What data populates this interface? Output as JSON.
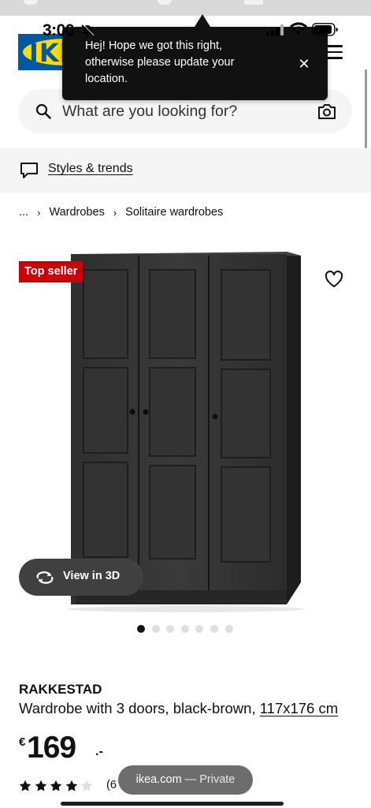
{
  "status_bar": {
    "time": "3:00",
    "icons": [
      "bell-muted-icon",
      "cellular-signal-icon",
      "wifi-icon",
      "battery-icon"
    ]
  },
  "header": {
    "logo_text": "IKEA",
    "menu_icon": "hamburger-menu-icon"
  },
  "location_popup": {
    "message": "Hej! Hope we got this right, otherwise please update your location.",
    "close_label": "✕"
  },
  "search": {
    "placeholder": "What are you looking for?",
    "value": "",
    "icons": [
      "search-icon",
      "camera-icon"
    ]
  },
  "styles_trends": {
    "label": "Styles & trends",
    "icon": "chat-bubble-icon"
  },
  "breadcrumb": {
    "items": [
      "...",
      "Wardrobes",
      "Solitaire wardrobes"
    ]
  },
  "product": {
    "badge": "Top seller",
    "view_3d_label": "View in 3D",
    "image_count": 7,
    "active_image_index": 0,
    "name": "RAKKESTAD",
    "description": "Wardrobe with 3 doors, black-brown, ",
    "dimensions": "117x176 cm",
    "price": {
      "currency": "€",
      "integer": "169",
      "decimal": ".-"
    },
    "rating": {
      "filled_stars": 4,
      "total_stars": 5,
      "count_text": "(6"
    }
  },
  "browser": {
    "domain": "ikea.com",
    "mode_label": "— Private"
  },
  "colors": {
    "ikea_blue": "#0058a3",
    "ikea_yellow": "#ffdb00",
    "badge_red": "#cc0008",
    "popup_bg": "#111111",
    "panel_gray": "#f5f5f5"
  }
}
